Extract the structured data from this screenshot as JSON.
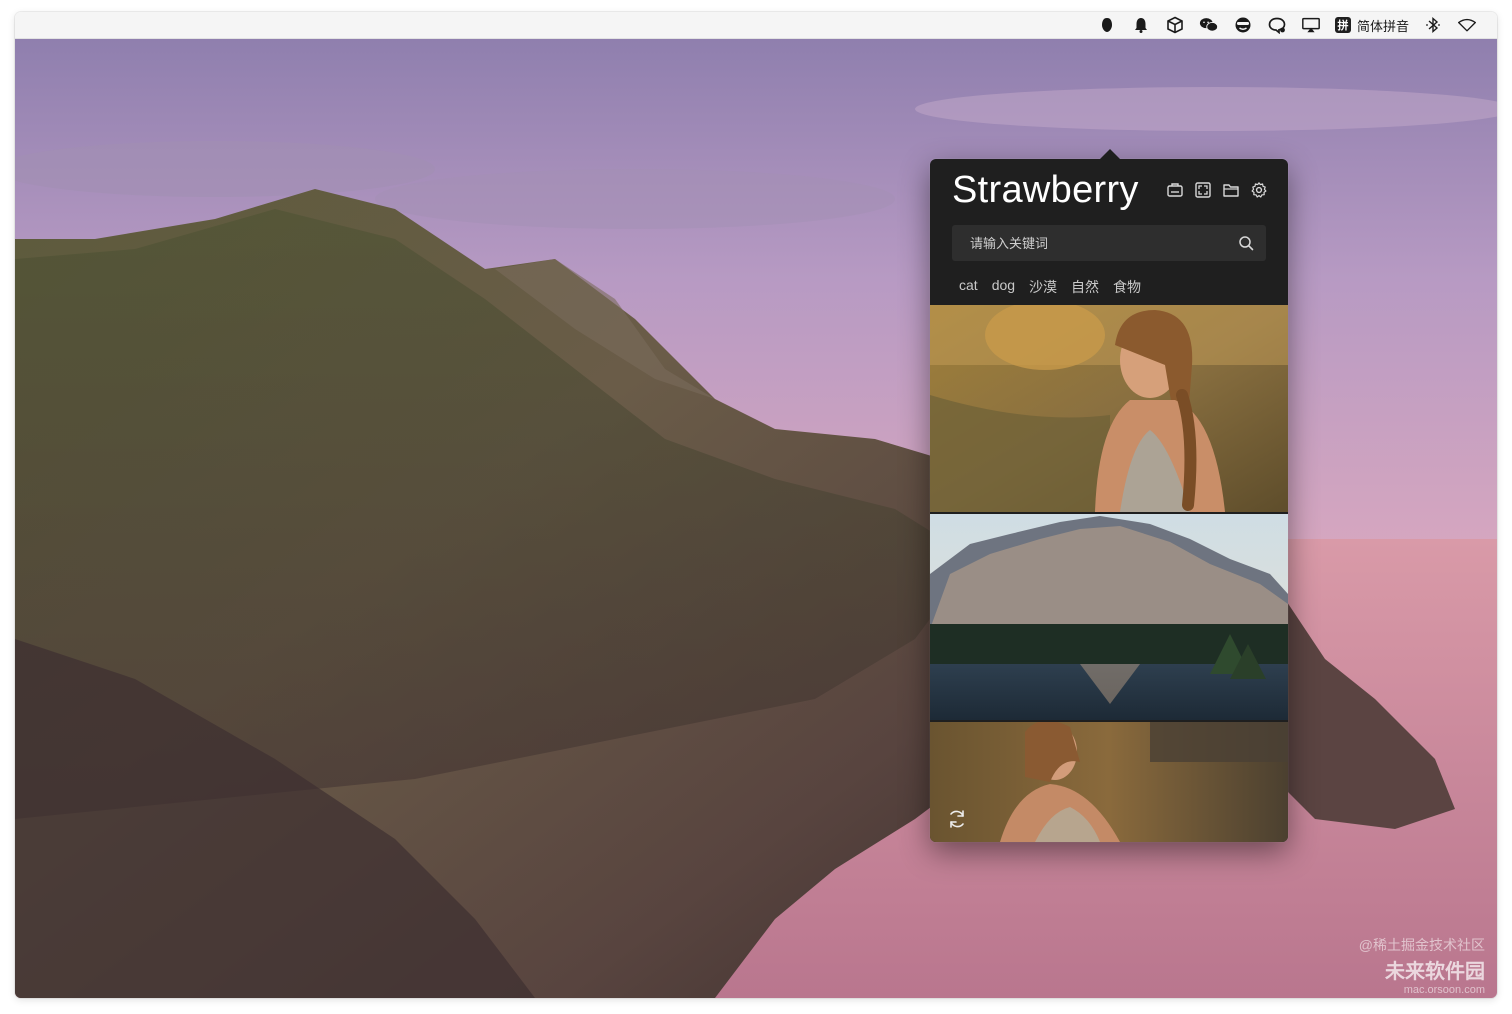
{
  "menubar": {
    "icons": [
      "app-icon",
      "bell-icon",
      "cube-icon",
      "wechat-icon",
      "face-icon",
      "chat-icon",
      "airplay-icon"
    ],
    "ime_badge": "拼",
    "ime_label": "简体拼音",
    "extra_icons": [
      "bluetooth-icon",
      "wifi-icon"
    ]
  },
  "popover": {
    "title": "Strawberry",
    "tools": [
      "wallpaper-icon",
      "fullscreen-icon",
      "folder-icon",
      "settings-icon"
    ],
    "search": {
      "placeholder": "请输入关键词"
    },
    "tags": [
      "cat",
      "dog",
      "沙漠",
      "自然",
      "食物"
    ],
    "gallery": [
      {
        "name": "photo-woman-field"
      },
      {
        "name": "photo-mountain-lake"
      },
      {
        "name": "photo-woman-hay"
      }
    ],
    "refresh_icon": "refresh-icon"
  },
  "watermark": {
    "line1": "@稀土掘金技术社区",
    "line2": "未来软件园",
    "line3": "mac.orsoon.com"
  },
  "colors": {
    "popover_bg": "#1f1f1f",
    "search_bg": "#2e2e2e",
    "menubar_bg": "#f5f5f5"
  }
}
